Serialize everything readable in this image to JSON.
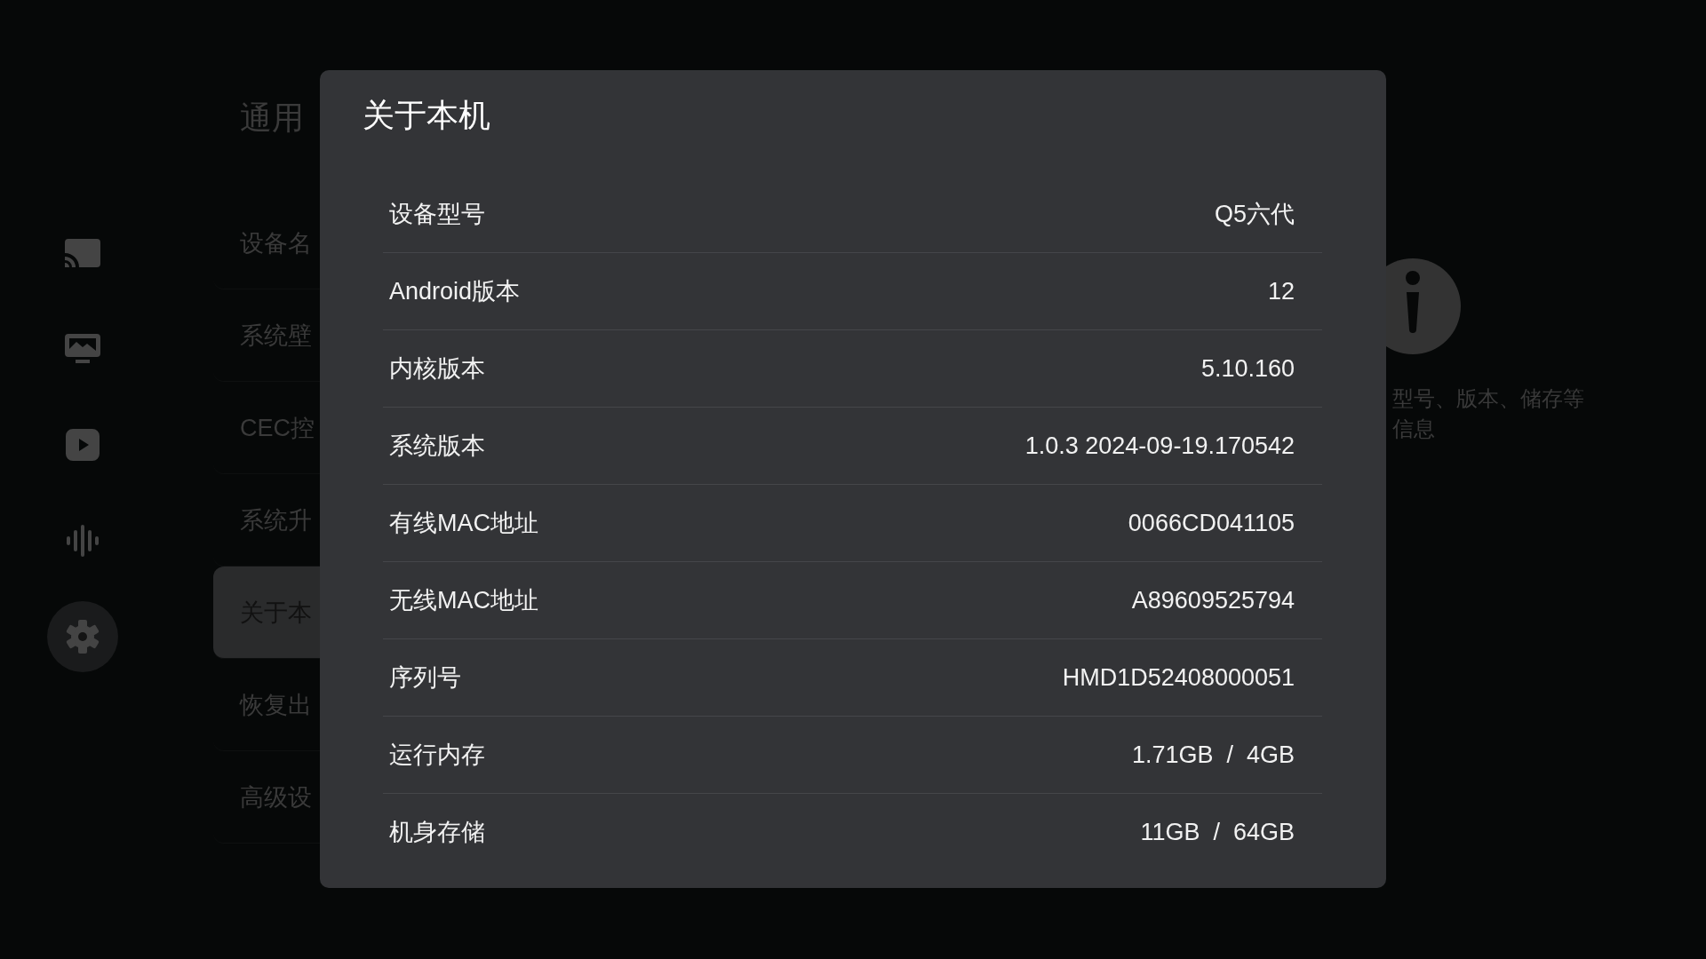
{
  "sidebar": {
    "items": [
      {
        "kind": "cast",
        "selected": false
      },
      {
        "kind": "wallpaper",
        "selected": false
      },
      {
        "kind": "play",
        "selected": false
      },
      {
        "kind": "audio",
        "selected": false
      },
      {
        "kind": "settings",
        "selected": true
      }
    ]
  },
  "menu": {
    "title": "通用",
    "items": [
      {
        "label": "设备名",
        "selected": false
      },
      {
        "label": "系统壁",
        "selected": false
      },
      {
        "label": "CEC控",
        "selected": false
      },
      {
        "label": "系统升",
        "selected": false
      },
      {
        "label": "关于本",
        "selected": true
      },
      {
        "label": "恢复出",
        "selected": false
      },
      {
        "label": "高级设",
        "selected": false
      }
    ]
  },
  "detail": {
    "description": "型号、版本、储存等信息"
  },
  "dialog": {
    "title": "关于本机",
    "rows": [
      {
        "label": "设备型号",
        "value": "Q5六代"
      },
      {
        "label": "Android版本",
        "value": "12"
      },
      {
        "label": "内核版本",
        "value": "5.10.160"
      },
      {
        "label": "系统版本",
        "value": "1.0.3 2024-09-19.170542"
      },
      {
        "label": "有线MAC地址",
        "value": "0066CD041105"
      },
      {
        "label": "无线MAC地址",
        "value": "A89609525794"
      },
      {
        "label": "序列号",
        "value": "HMD1D52408000051"
      },
      {
        "label": "运行内存",
        "value": "1.71GB  /  4GB"
      },
      {
        "label": "机身存储",
        "value": "11GB  /  64GB"
      }
    ]
  }
}
